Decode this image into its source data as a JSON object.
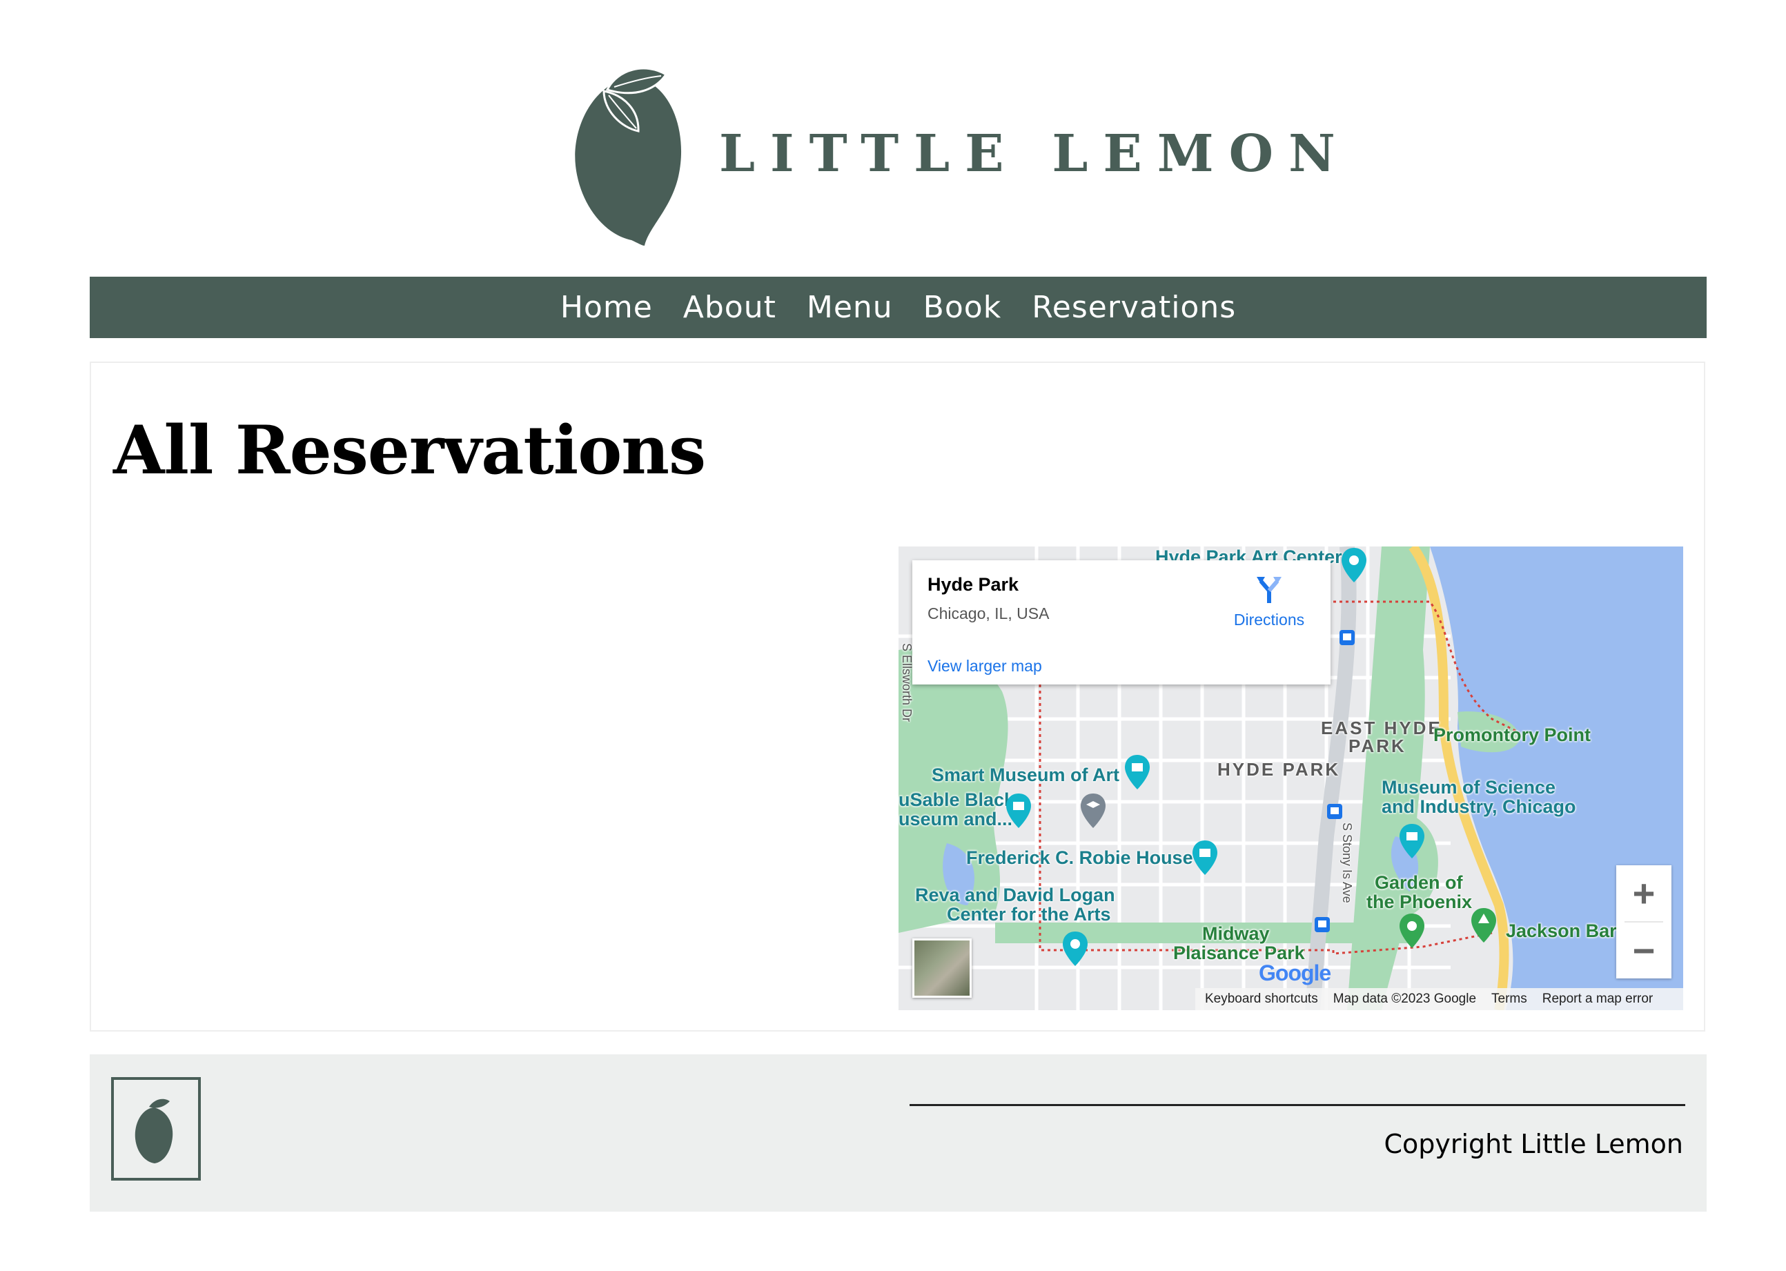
{
  "brand": {
    "name": "LITTLE LEMON",
    "color": "#495e57"
  },
  "nav": {
    "items": [
      {
        "label": "Home"
      },
      {
        "label": "About"
      },
      {
        "label": "Menu"
      },
      {
        "label": "Book"
      },
      {
        "label": "Reservations"
      }
    ]
  },
  "main": {
    "title": "All Reservations"
  },
  "map": {
    "place_title": "Hyde Park",
    "place_subtitle": "Chicago, IL, USA",
    "directions_label": "Directions",
    "view_larger_label": "View larger map",
    "zoom_in": "+",
    "zoom_out": "−",
    "labels": {
      "hyde_park_art_center": "Hyde Park Art Center",
      "east_hyde_park": "EAST HYDE",
      "east_hyde_park_2": "PARK",
      "hyde_park": "HYDE PARK",
      "promontory_point": "Promontory Point",
      "smart_museum": "Smart Museum of Art",
      "dusable_1": "uSable Black",
      "dusable_2": "useum and...",
      "museum_sci_1": "Museum of Science",
      "museum_sci_2": "and Industry, Chicago",
      "robie_house": "Frederick C. Robie House",
      "garden_phoenix_1": "Garden of",
      "garden_phoenix_2": "the Phoenix",
      "logan_1": "Reva and David Logan",
      "logan_2": "Center for the Arts",
      "midway_1": "Midway",
      "midway_2": "Plaisance Park",
      "jackson": "Jackson Bar",
      "stony_island": "S Stony Is Ave",
      "ellsworth": "S Ellsworth Dr",
      "google": "Google"
    },
    "footer": {
      "shortcuts": "Keyboard shortcuts",
      "map_data": "Map data ©2023 Google",
      "terms": "Terms",
      "report": "Report a map error"
    },
    "colors": {
      "water": "#9bbcf0",
      "park": "#a8dab5",
      "road_major": "#f7d36b",
      "link": "#1a73e8"
    }
  },
  "footer": {
    "copyright": "Copyright Little Lemon",
    "bg": "#edefee"
  }
}
